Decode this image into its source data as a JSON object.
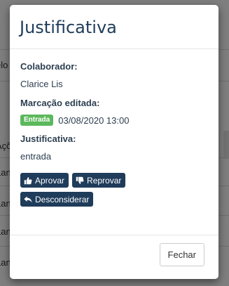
{
  "background": {
    "fragments": [
      "elo",
      "Açõ",
      "Lan",
      "Lan",
      "Lan",
      "Lan"
    ]
  },
  "modal": {
    "title": "Justificativa",
    "colaborador": {
      "label": "Colaborador:",
      "value": "Clarice Lis"
    },
    "marcacao": {
      "label": "Marcação editada:",
      "badge": "Entrada",
      "datetime": "03/08/2020 13:00"
    },
    "justificativa": {
      "label": "Justificativa:",
      "value": "entrada"
    },
    "actions": {
      "approve": "Aprovar",
      "reject": "Reprovar",
      "disregard": "Desconsiderar"
    },
    "footer": {
      "close": "Fechar"
    }
  },
  "colors": {
    "primary": "#1f3c5a",
    "badge": "#5cb85c"
  }
}
